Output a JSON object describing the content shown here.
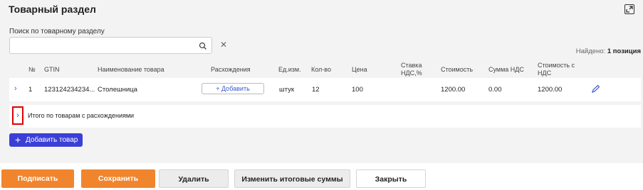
{
  "header": {
    "title": "Товарный раздел",
    "expand_icon": "expand-icon"
  },
  "search": {
    "label": "Поиск по товарному разделу",
    "value": "",
    "placeholder": ""
  },
  "found": {
    "prefix": "Найдено:",
    "count": "1 позиция"
  },
  "table": {
    "headers": {
      "num": "№",
      "gtin": "GTIN",
      "name": "Наименование товара",
      "diff": "Расхождения",
      "unit": "Ед.изм.",
      "qty": "Кол-во",
      "price": "Цена",
      "vat_rate_1": "Ставка",
      "vat_rate_2": "НДС,%",
      "cost": "Стоимость",
      "vat_sum": "Сумма НДС",
      "cost_vat_1": "Стоимость с",
      "cost_vat_2": "НДС"
    },
    "rows": [
      {
        "num": "1",
        "gtin": "123124234234...",
        "name": "Столешница",
        "diff_button": "+ Добавить",
        "unit": "штук",
        "qty": "12",
        "price": "100",
        "vat_rate": "",
        "cost": "1200.00",
        "vat_sum": "0.00",
        "cost_vat": "1200.00"
      }
    ]
  },
  "totals": {
    "label": "Итого по товарам с расхождениями"
  },
  "add_product": {
    "label": "Добавить товар"
  },
  "actions": {
    "sign": "Подписать",
    "save": "Сохранить",
    "delete": "Удалить",
    "change_totals": "Изменить итоговые суммы",
    "close": "Закрыть"
  },
  "colors": {
    "accent": "#3b3fd6",
    "primary_button": "#f0852d",
    "highlight": "#dd0000"
  }
}
